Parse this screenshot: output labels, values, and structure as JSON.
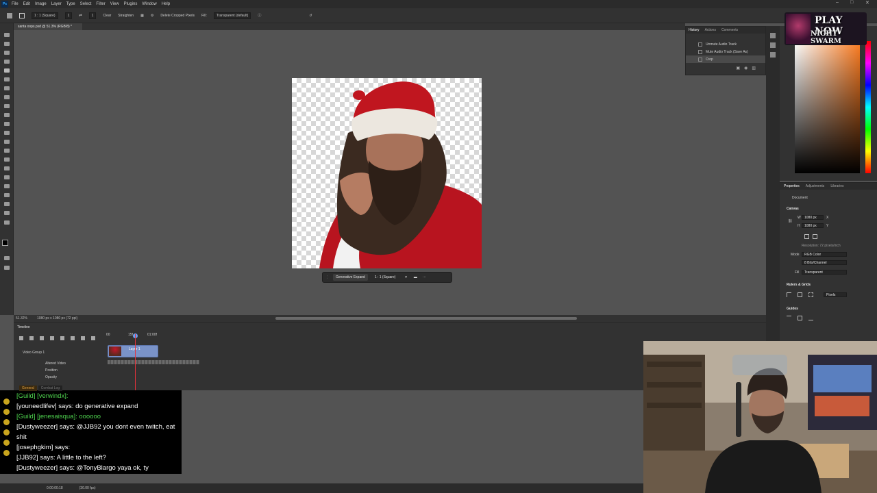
{
  "app": {
    "menu": [
      "File",
      "Edit",
      "Image",
      "Layer",
      "Type",
      "Select",
      "Filter",
      "View",
      "Plugins",
      "Window",
      "Help"
    ],
    "window_controls": [
      "–",
      "□",
      "✕"
    ]
  },
  "options_bar": {
    "ratio": "1 : 1 (Square)",
    "ratio_w": "1",
    "ratio_h": "1",
    "clear": "Clear",
    "straighten": "Straighten",
    "delete_cropped": "Delete Cropped Pixels",
    "fill_label": "Fill:",
    "fill_value": "Transparent (default)"
  },
  "document": {
    "tab_title": "santa oops.psd @ 51.3% (RGB/8) *",
    "zoom": "51.32%",
    "size_info": "1080 px x 1080 px (72 ppi)"
  },
  "context_bar": {
    "generative_expand": "Generative Expand",
    "aspect": "1 : 1 (Square)"
  },
  "history_panel": {
    "tabs": [
      "History",
      "Actions",
      "Comments"
    ],
    "items": [
      {
        "label": "Unmute Audio Track"
      },
      {
        "label": "Mute Audio Track (Save As)"
      },
      {
        "label": "Crop"
      }
    ]
  },
  "promo": {
    "line1": "PLAY NOW",
    "line2": "NIGHT SWARM"
  },
  "properties_panel": {
    "tabs": [
      "Properties",
      "Adjustments",
      "Libraries"
    ],
    "document_label": "Document",
    "canvas_label": "Canvas",
    "w_label": "W",
    "w_value": "1080 px",
    "h_label": "H",
    "h_value": "1080 px",
    "x_label": "X",
    "y_label": "Y",
    "resolution": "Resolution: 72 pixels/inch",
    "mode_label": "Mode",
    "mode_value": "RGB Color",
    "depth_value": "8 Bits/Channel",
    "fill_label": "Fill",
    "fill_value": "Transparent",
    "rulers_label": "Rulers & Grids",
    "units_value": "Pixels",
    "guides_label": "Guides"
  },
  "timeline": {
    "title": "Timeline",
    "tick_start": "00",
    "tick_mid": "15f",
    "tick_end": "01:00f",
    "group_label": "Video Group 1",
    "clip_label": "Layer 1",
    "sub_items": [
      "Altered Video",
      "Position",
      "Opacity"
    ],
    "timecode": "0:00:00:18",
    "fps": "(30.00 fps)"
  },
  "chat": {
    "tabs": [
      "General",
      "Combat Log"
    ],
    "messages": [
      {
        "text": "[Guild] [verwindx]:",
        "guild": true
      },
      {
        "text": "[youneedlifev] says: do generative expand",
        "guild": false
      },
      {
        "text": "[Guild] [jenesaisqua]: oooooo",
        "guild": true
      },
      {
        "text": "[Dustyweezer] says: @JJB92 you dont even twitch, eat shit",
        "guild": false
      },
      {
        "text": "[josephgkim] says:",
        "guild": false
      },
      {
        "text": "[JJB92] says: A little to the left?",
        "guild": false
      },
      {
        "text": "[Dustyweezer] says: @TonyBlargo yaya ok, ty",
        "guild": false
      }
    ]
  },
  "colors": {
    "accent_red": "#e8323c",
    "clip_blue": "#7a93c8",
    "guild_green": "#4fd54f"
  }
}
